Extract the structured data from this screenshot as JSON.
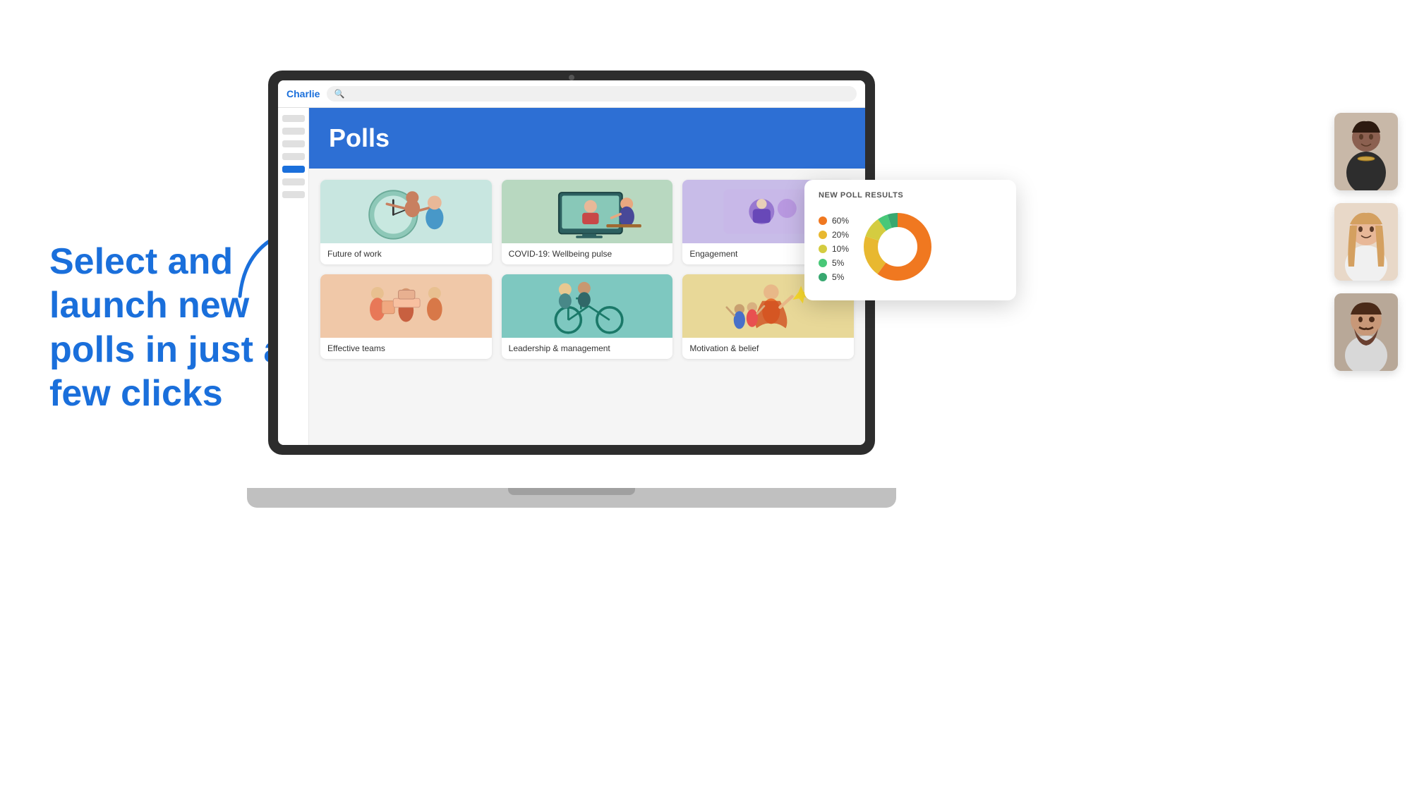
{
  "app": {
    "name": "Charlie"
  },
  "left_text": {
    "headline": "Select and launch new polls in just a few clicks"
  },
  "polls_page": {
    "title": "Polls",
    "search_placeholder": ""
  },
  "sidebar": {
    "items": [
      {
        "active": false
      },
      {
        "active": false
      },
      {
        "active": false
      },
      {
        "active": false
      },
      {
        "active": true
      },
      {
        "active": false
      },
      {
        "active": false
      }
    ]
  },
  "poll_cards": [
    {
      "label": "Future of work",
      "color": "card-teal"
    },
    {
      "label": "COVID-19: Wellbeing pulse",
      "color": "card-green"
    },
    {
      "label": "Engagement",
      "color": "card-purple"
    },
    {
      "label": "Effective teams",
      "color": "card-orange"
    },
    {
      "label": "Leadership & management",
      "color": "card-teal2"
    },
    {
      "label": "Motivation & belief",
      "color": "card-yellow"
    }
  ],
  "poll_results": {
    "title": "NEW POLL RESULTS",
    "legend": [
      {
        "color": "#f07820",
        "value": "60%"
      },
      {
        "color": "#e8b830",
        "value": "20%"
      },
      {
        "color": "#d4cc40",
        "value": "10%"
      },
      {
        "color": "#48c878",
        "value": "5%"
      },
      {
        "color": "#38a870",
        "value": "5%"
      }
    ]
  },
  "icons": {
    "search": "🔍"
  }
}
